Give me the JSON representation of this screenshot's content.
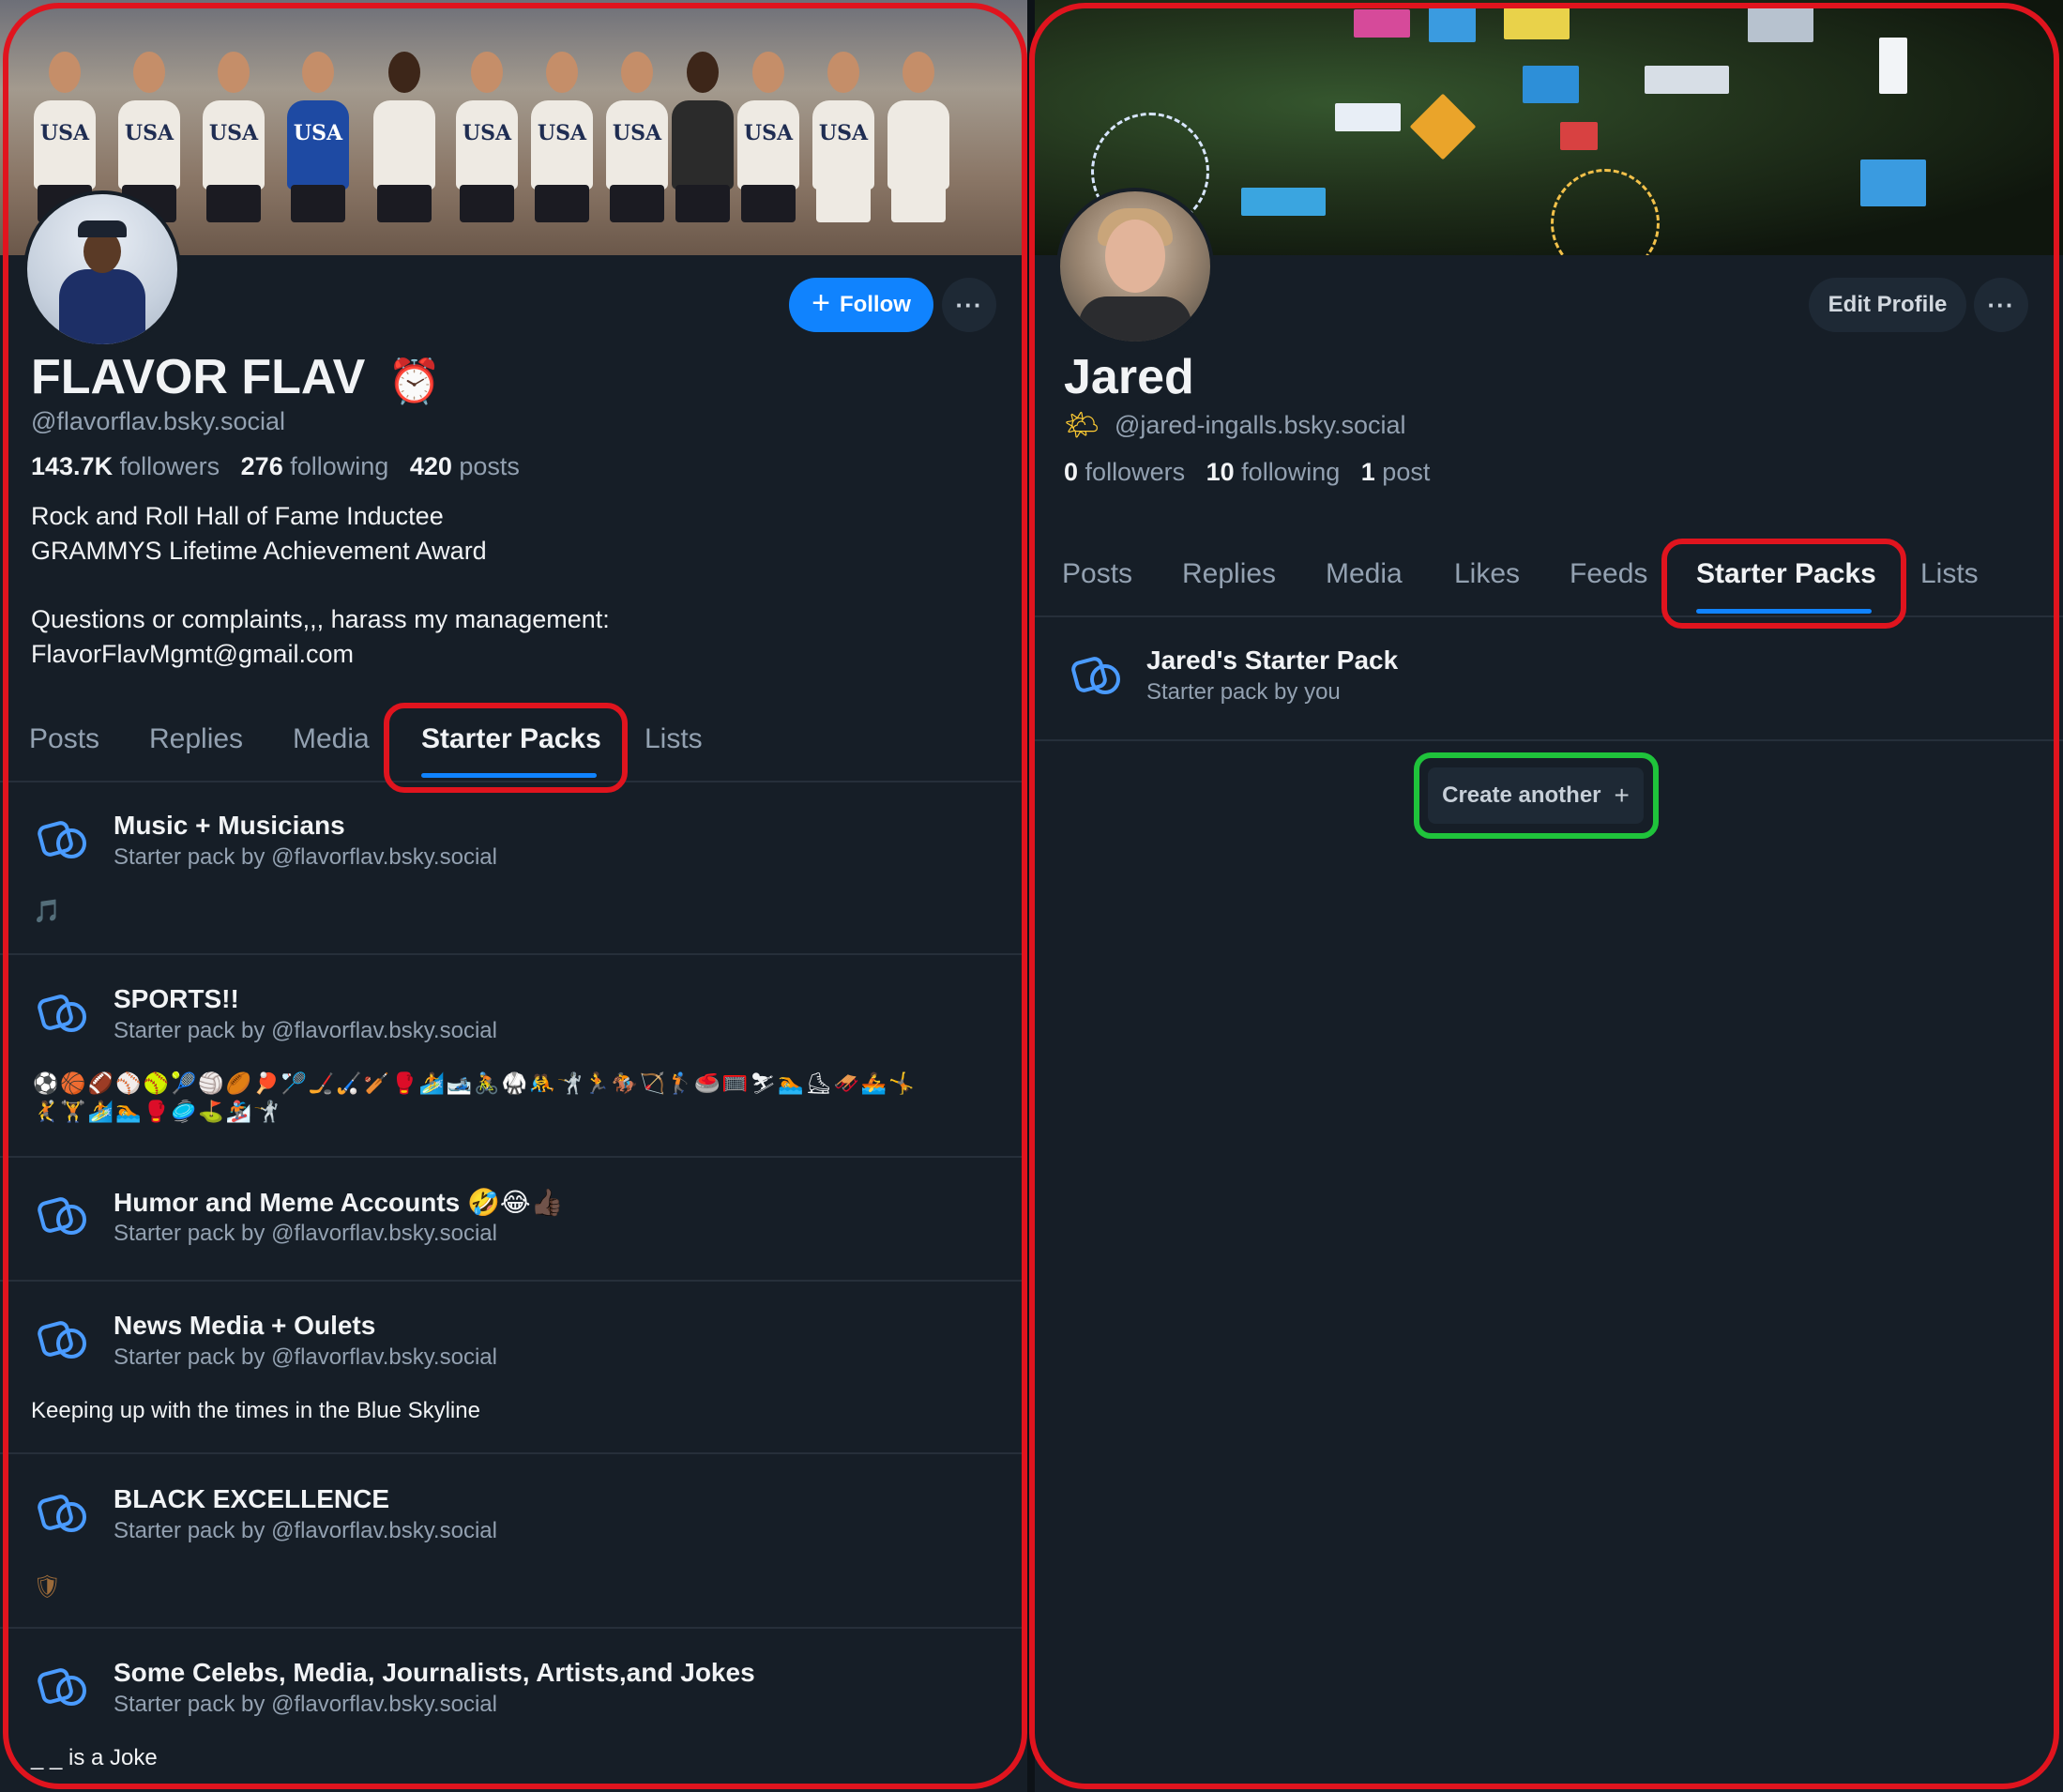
{
  "left": {
    "banner_shirts": [
      "USA",
      "USA",
      "USA",
      "USA",
      "USA",
      "USA",
      "USA",
      "USA",
      "USA"
    ],
    "follow_label": "Follow",
    "more_label": "···",
    "display_name": "FLAVOR FLAV",
    "name_icon": "⏰",
    "handle": "@flavorflav.bsky.social",
    "stats": {
      "followers_count": "143.7K",
      "followers_label": "followers",
      "following_count": "276",
      "following_label": "following",
      "posts_count": "420",
      "posts_label": "posts"
    },
    "bio": [
      "Rock and Roll Hall of Fame Inductee",
      "GRAMMYS Lifetime Achievement Award",
      "",
      "Questions or complaints,,, harass my management:",
      "FlavorFlavMgmt@gmail.com"
    ],
    "tabs": [
      "Posts",
      "Replies",
      "Media",
      "Starter Packs",
      "Lists"
    ],
    "active_tab": "Starter Packs",
    "packs": [
      {
        "title": "Music + Musicians",
        "subtitle": "Starter pack by @flavorflav.bsky.social",
        "extra": "🎵"
      },
      {
        "title": "SPORTS!!",
        "subtitle": "Starter pack by @flavorflav.bsky.social",
        "extra": "⚽🏀🏈⚾🥎🎾🏐🏉🏓🏸🏒🏑🏏🥊🏄🎿🚴🥋🤼🤺🏃🏇🏹🏌🥌🥅⛷🏊⛸🛷🚣🤸",
        "extra2": "🤾🏋🏄🏊🥊🥏⛳🏂🤺"
      },
      {
        "title": "Humor and Meme Accounts 🤣😂👍🏿",
        "subtitle": "Starter pack by @flavorflav.bsky.social",
        "extra": ""
      },
      {
        "title": "News Media + Oulets",
        "subtitle": "Starter pack by @flavorflav.bsky.social",
        "extra": "Keeping up with the times in the Blue Skyline"
      },
      {
        "title": "BLACK EXCELLENCE",
        "subtitle": "Starter pack by @flavorflav.bsky.social",
        "extra": "🛡"
      },
      {
        "title": "Some Celebs, Media, Journalists, Artists,and Jokes",
        "subtitle": "Starter pack by @flavorflav.bsky.social",
        "extra": "_ _ is a Joke"
      }
    ]
  },
  "right": {
    "edit_label": "Edit Profile",
    "more_label": "···",
    "display_name": "Jared",
    "handle_icon": "🌤",
    "handle": "@jared-ingalls.bsky.social",
    "stats": {
      "followers_count": "0",
      "followers_label": "followers",
      "following_count": "10",
      "following_label": "following",
      "posts_count": "1",
      "posts_label": "post"
    },
    "tabs": [
      "Posts",
      "Replies",
      "Media",
      "Likes",
      "Feeds",
      "Starter Packs",
      "Lists"
    ],
    "active_tab": "Starter Packs",
    "pack": {
      "title": "Jared's Starter Pack",
      "subtitle": "Starter pack by you"
    },
    "create_label": "Create another",
    "create_icon": "+"
  },
  "colors": {
    "background": "#161e27",
    "accent": "#1083fe",
    "muted_text": "#93a1b1",
    "highlight_red": "#e0141e",
    "highlight_green": "#1fc33b"
  }
}
